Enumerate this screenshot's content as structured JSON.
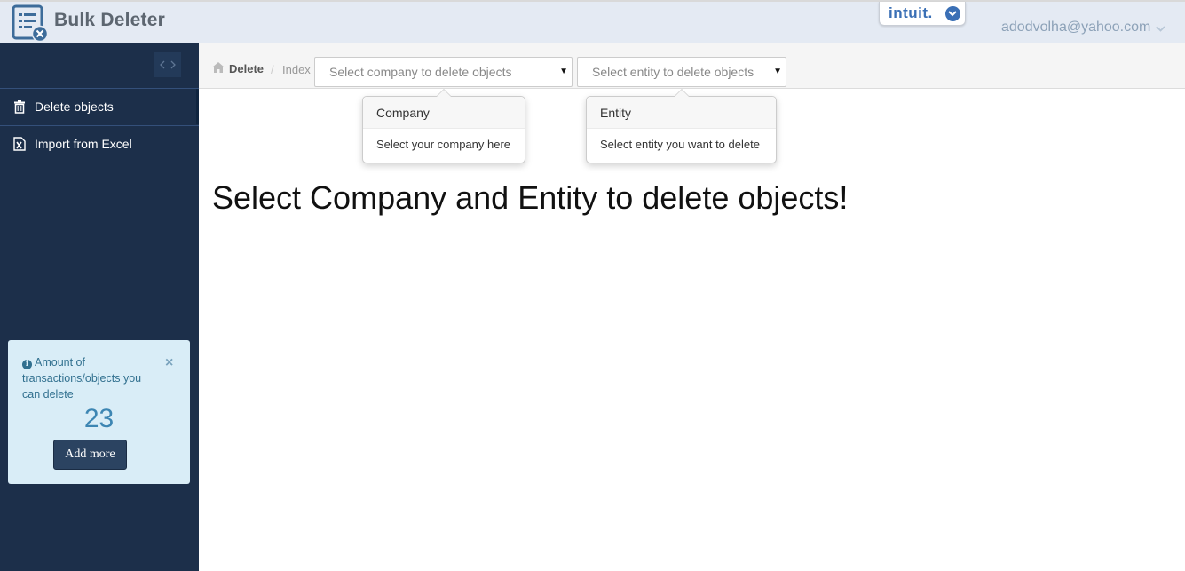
{
  "app": {
    "title": "Bulk Deleter",
    "logo_icon": "list-delete-icon"
  },
  "header": {
    "partner_logo": "intuit",
    "user_email": "adodvolha@yahoo.com"
  },
  "sidebar": {
    "items": [
      {
        "label": "Delete objects",
        "icon": "trash-icon",
        "active": true
      },
      {
        "label": "Import from Excel",
        "icon": "excel-icon",
        "active": false
      }
    ],
    "info": {
      "message": "Amount of transactions/objects you can delete",
      "count": "23",
      "button_label": "Add more",
      "close_glyph": "×"
    }
  },
  "breadcrumb": {
    "home_label": "Delete",
    "separator": "/",
    "current": "Index"
  },
  "selects": {
    "company": {
      "placeholder": "Select company to delete objects"
    },
    "entity": {
      "placeholder": "Select entity to delete objects"
    }
  },
  "popovers": {
    "company": {
      "title": "Company",
      "body": "Select your company here"
    },
    "entity": {
      "title": "Entity",
      "body": "Select entity you want to delete"
    }
  },
  "main": {
    "headline": "Select Company and Entity to delete objects!"
  },
  "colors": {
    "sidebar_bg": "#1c2f4a",
    "topbar_bg": "#e4eaf3",
    "info_bg": "#d9edf7",
    "intuit_blue": "#3a6fb5"
  }
}
